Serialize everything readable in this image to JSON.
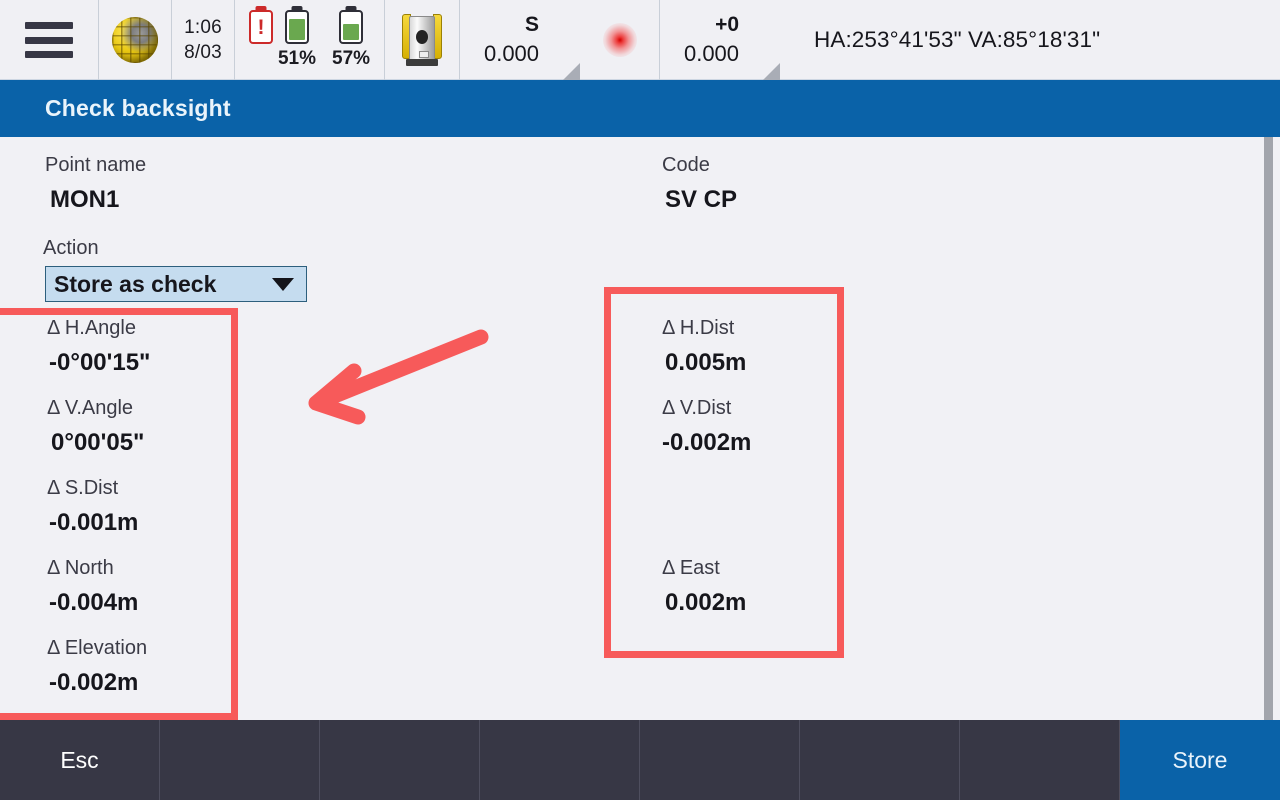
{
  "statusbar": {
    "menu_icon": "hamburger-menu-icon",
    "globe_icon": "globe-icon",
    "datetime": {
      "time": "1:06",
      "date": "8/03"
    },
    "batteries": [
      {
        "icon": "battery-alert-icon",
        "level": null,
        "label": ""
      },
      {
        "icon": "battery-icon",
        "level": 51,
        "label": "51%"
      },
      {
        "icon": "battery-icon",
        "level": 57,
        "label": "57%"
      }
    ],
    "instrument_icon": "total-station-icon",
    "target": {
      "top": "S",
      "bottom": "0.000"
    },
    "laser_icon": "laser-dot-icon",
    "prism": {
      "top": "+0",
      "bottom": "0.000"
    },
    "angles": "HA:253°41'53\"  VA:85°18'31\""
  },
  "header": {
    "title": "Check backsight"
  },
  "form": {
    "point_name": {
      "label": "Point name",
      "value": "MON1"
    },
    "code": {
      "label": "Code",
      "value": "SV CP"
    },
    "action": {
      "label": "Action",
      "value": "Store as check",
      "caret_icon": "chevron-down-icon"
    }
  },
  "deltas": {
    "left": [
      {
        "label": "Δ H.Angle",
        "value": "-0°00'15\""
      },
      {
        "label": "Δ V.Angle",
        "value": "0°00'05\""
      },
      {
        "label": "Δ S.Dist",
        "value": "-0.001m"
      },
      {
        "label": "Δ North",
        "value": "-0.004m"
      },
      {
        "label": "Δ Elevation",
        "value": "-0.002m"
      }
    ],
    "right": [
      {
        "label": "Δ H.Dist",
        "value": "0.005m"
      },
      {
        "label": "Δ V.Dist",
        "value": "-0.002m"
      },
      {
        "label": "Δ East",
        "value": "0.002m"
      }
    ]
  },
  "annotations": {
    "highlight_color": "#f75a5a",
    "arrow_color": "#f75a5a"
  },
  "bottombar": {
    "buttons": [
      "Esc",
      "",
      "",
      "",
      "",
      "",
      ""
    ],
    "store_label": "Store"
  },
  "colors": {
    "header_blue": "#0a62a8",
    "bottom_dark": "#373745",
    "page_bg": "#f1f1f5",
    "dropdown_bg": "#c5dcef"
  }
}
